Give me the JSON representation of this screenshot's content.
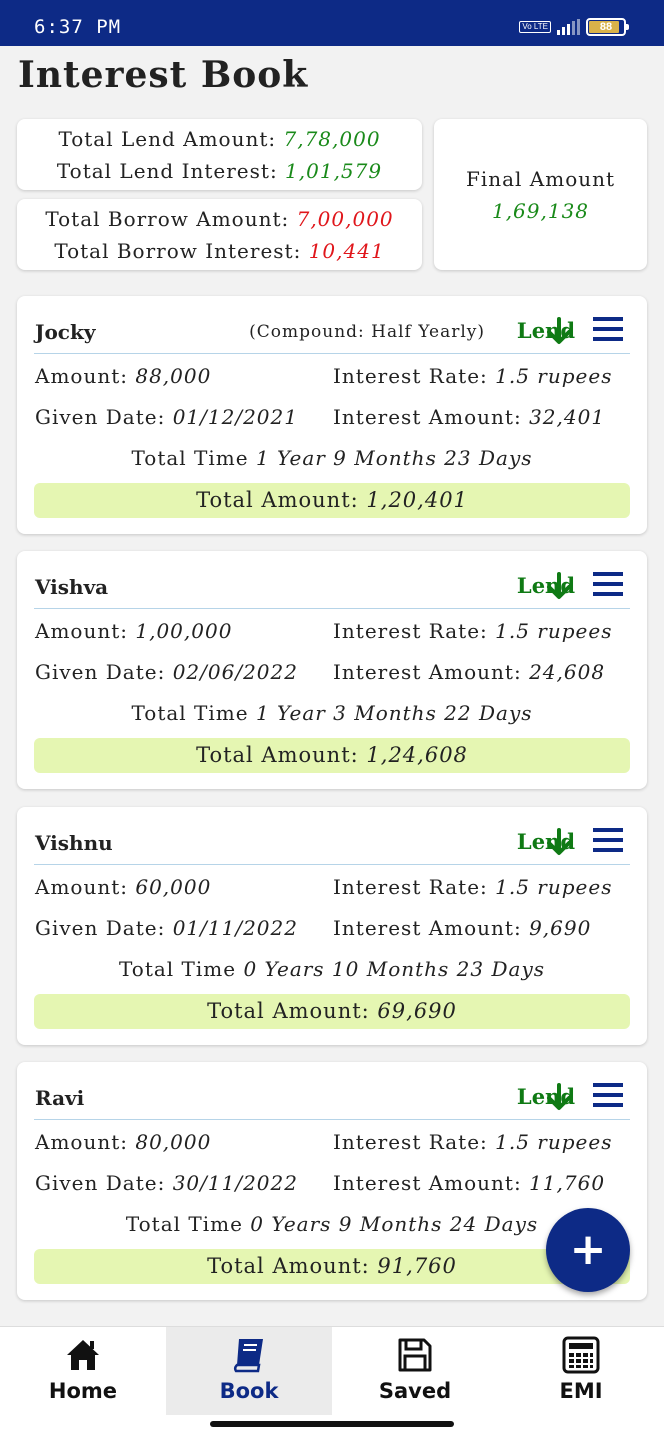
{
  "status_bar": {
    "time": "6:37 PM",
    "volte": "Vo LTE",
    "battery": "88",
    "battery_level": 0.88
  },
  "app_title": "Interest Book",
  "summary": {
    "lend_amount_label": "Total Lend Amount:",
    "lend_amount": "7,78,000",
    "lend_interest_label": "Total Lend Interest:",
    "lend_interest": "1,01,579",
    "borrow_amount_label": "Total Borrow Amount:",
    "borrow_amount": "7,00,000",
    "borrow_interest_label": "Total Borrow Interest:",
    "borrow_interest": "10,441",
    "final_label": "Final Amount",
    "final_amount": "1,69,138"
  },
  "labels": {
    "amount": "Amount:",
    "interest_rate": "Interest Rate:",
    "given_date": "Given Date:",
    "interest_amount": "Interest Amount:",
    "total_time": "Total Time",
    "total_amount": "Total Amount:"
  },
  "records": [
    {
      "name": "Jocky",
      "compound": "(Compound:  Half Yearly)",
      "type": "Lend",
      "amount": "88,000",
      "rate": "1.5 rupees",
      "given_date": "01/12/2021",
      "interest_amount": "32,401",
      "time_value": "1 Year 9 Months 23 Days",
      "total_amount": "1,20,401"
    },
    {
      "name": "Vishva",
      "compound": "",
      "type": "Lend",
      "amount": "1,00,000",
      "rate": "1.5 rupees",
      "given_date": "02/06/2022",
      "interest_amount": "24,608",
      "time_value": "1 Year 3 Months 22 Days",
      "total_amount": "1,24,608"
    },
    {
      "name": "Vishnu",
      "compound": "",
      "type": "Lend",
      "amount": "60,000",
      "rate": "1.5 rupees",
      "given_date": "01/11/2022",
      "interest_amount": "9,690",
      "time_value": "0 Years 10 Months 23 Days",
      "total_amount": "69,690"
    },
    {
      "name": "Ravi",
      "compound": "",
      "type": "Lend",
      "amount": "80,000",
      "rate": "1.5 rupees",
      "given_date": "30/11/2022",
      "interest_amount": "11,760",
      "time_value": "0 Years 9 Months 24 Days",
      "total_amount": "91,760"
    }
  ],
  "fab": {
    "label": "+"
  },
  "nav": [
    {
      "label": "Home",
      "icon": "home-icon"
    },
    {
      "label": "Book",
      "icon": "book-icon"
    },
    {
      "label": "Saved",
      "icon": "save-icon"
    },
    {
      "label": "EMI",
      "icon": "calculator-icon"
    }
  ],
  "colors": {
    "primary": "#0d2a86",
    "lend_green": "#1a8a1a",
    "borrow_red": "#e0161b",
    "total_bar": "#e5f6b2"
  }
}
